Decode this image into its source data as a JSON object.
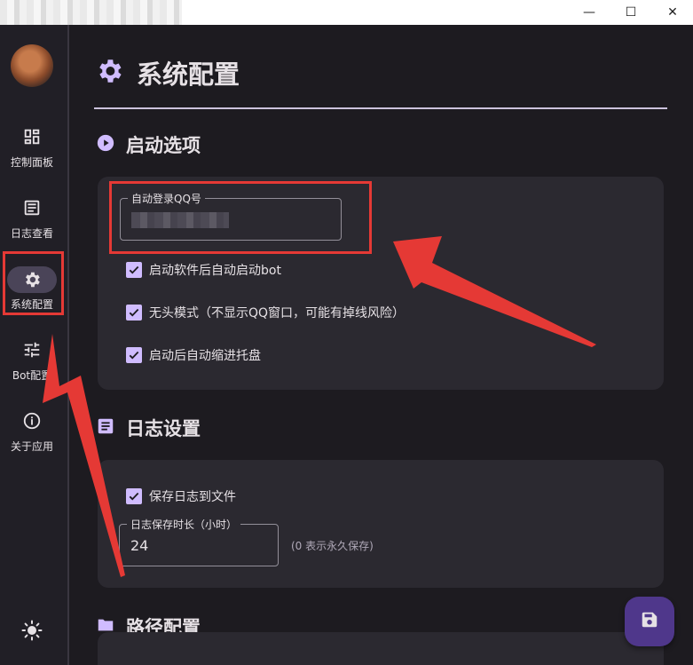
{
  "window": {
    "controls": {
      "minimize": "—",
      "maximize": "☐",
      "close": "✕"
    }
  },
  "sidebar": {
    "items": [
      {
        "label": "控制面板",
        "icon": "dashboard-icon"
      },
      {
        "label": "日志查看",
        "icon": "article-icon"
      },
      {
        "label": "系统配置",
        "icon": "gear-icon",
        "active": true
      },
      {
        "label": "Bot配置",
        "icon": "tune-icon"
      },
      {
        "label": "关于应用",
        "icon": "info-icon"
      }
    ],
    "theme_icon": "sun-icon"
  },
  "main": {
    "title": "系统配置",
    "sections": {
      "startup": {
        "title": "启动选项",
        "qq_field_label": "自动登录QQ号",
        "checkboxes": [
          {
            "label": "启动软件后自动启动bot",
            "checked": true
          },
          {
            "label": "无头模式（不显示QQ窗口，可能有掉线风险）",
            "checked": true
          },
          {
            "label": "启动后自动缩进托盘",
            "checked": true
          }
        ]
      },
      "log": {
        "title": "日志设置",
        "checkbox": {
          "label": "保存日志到文件",
          "checked": true
        },
        "duration_label": "日志保存时长（小时）",
        "duration_value": "24",
        "duration_hint": "(0 表示永久保存)"
      },
      "path": {
        "title": "路径配置"
      }
    }
  },
  "colors": {
    "accent": "#d0bcff",
    "annotation": "#e53935",
    "background": "#1d1b20",
    "card": "#2b2930"
  }
}
